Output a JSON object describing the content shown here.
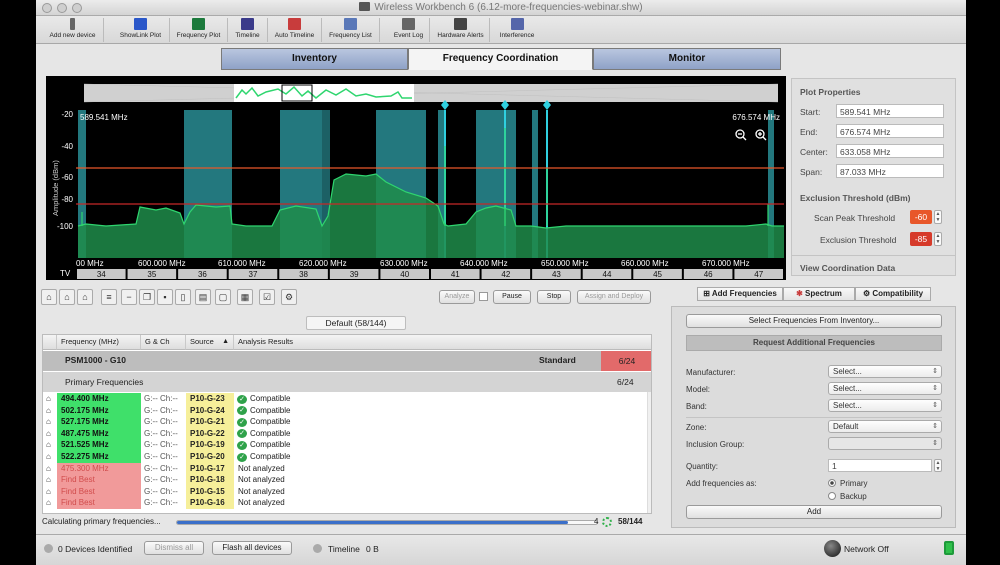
{
  "window": {
    "title": "Wireless Workbench 6 (6.12-more-frequencies-webinar.shw)"
  },
  "toolbar": [
    {
      "label": "Add new device",
      "icon": "add-device-icon",
      "color": "#666666"
    },
    {
      "label": "ShowLink Plot",
      "icon": "showlink-plot-icon",
      "color": "#2a57c9"
    },
    {
      "label": "Frequency Plot",
      "icon": "frequency-plot-icon",
      "color": "#1c7a3c"
    },
    {
      "label": "Timeline",
      "icon": "timeline-icon",
      "color": "#3a3a8a"
    },
    {
      "label": "Auto Timeline",
      "icon": "auto-timeline-icon",
      "color": "#c83c3c"
    },
    {
      "label": "Frequency List",
      "icon": "frequency-list-icon",
      "color": "#5a78b8"
    },
    {
      "label": "Event Log",
      "icon": "event-log-icon",
      "color": "#666666"
    },
    {
      "label": "Hardware Alerts",
      "icon": "hardware-alerts-icon",
      "color": "#444444"
    },
    {
      "label": "Interference",
      "icon": "interference-icon",
      "color": "#5566aa"
    }
  ],
  "tabs": [
    {
      "label": "Inventory",
      "active": false
    },
    {
      "label": "Frequency Coordination",
      "active": true
    },
    {
      "label": "Monitor",
      "active": false
    }
  ],
  "plot": {
    "start_label": "589.541 MHz",
    "end_label": "676.574 MHz",
    "ylabel": "Amplitude (dBm)",
    "y_ticks": [
      "-20",
      "-40",
      "-60",
      "-80",
      "-100"
    ],
    "x_ticks": [
      "00 MHz",
      "600.000 MHz",
      "610.000 MHz",
      "620.000 MHz",
      "630.000 MHz",
      "640.000 MHz",
      "650.000 MHz",
      "660.000 MHz",
      "670.000 MHz"
    ],
    "tv_label": "TV",
    "tv_channels": [
      "34",
      "35",
      "36",
      "37",
      "38",
      "39",
      "40",
      "41",
      "42",
      "43",
      "44",
      "45",
      "46",
      "47"
    ]
  },
  "plot_properties": {
    "title": "Plot Properties",
    "start_label": "Start:",
    "start": "589.541 MHz",
    "end_label": "End:",
    "end": "676.574 MHz",
    "center_label": "Center:",
    "center": "633.058 MHz",
    "span_label": "Span:",
    "span": "87.033 MHz",
    "exclusion_title": "Exclusion Threshold (dBm)",
    "scan_peak_label": "Scan Peak Threshold",
    "scan_peak": "-60",
    "exclusion_label": "Exclusion Threshold",
    "exclusion": "-85",
    "view_coord": "View Coordination Data"
  },
  "controls": {
    "analyze": "Analyze",
    "pause": "Pause",
    "stop": "Stop",
    "assign": "Assign and Deploy"
  },
  "group_selector": "Default (58/144)",
  "table": {
    "headers": [
      "Frequency (MHz)",
      "G & Ch",
      "Source",
      "Analysis Results"
    ],
    "sort_indicator": "▲",
    "group_name": "PSM1000 - G10",
    "group_type": "Standard",
    "group_count": "6/24",
    "subgroup": "Primary Frequencies",
    "subgroup_count": "6/24",
    "rows": [
      {
        "freq": "494.400 MHz",
        "gch": "G:-- Ch:--",
        "source": "P10-G-23",
        "result": "Compatible",
        "state": "ok"
      },
      {
        "freq": "502.175 MHz",
        "gch": "G:-- Ch:--",
        "source": "P10-G-24",
        "result": "Compatible",
        "state": "ok"
      },
      {
        "freq": "527.175 MHz",
        "gch": "G:-- Ch:--",
        "source": "P10-G-21",
        "result": "Compatible",
        "state": "ok"
      },
      {
        "freq": "487.475 MHz",
        "gch": "G:-- Ch:--",
        "source": "P10-G-22",
        "result": "Compatible",
        "state": "ok"
      },
      {
        "freq": "521.525 MHz",
        "gch": "G:-- Ch:--",
        "source": "P10-G-19",
        "result": "Compatible",
        "state": "ok"
      },
      {
        "freq": "522.275 MHz",
        "gch": "G:-- Ch:--",
        "source": "P10-G-20",
        "result": "Compatible",
        "state": "ok"
      },
      {
        "freq": "475.300 MHz",
        "gch": "G:-- Ch:--",
        "source": "P10-G-17",
        "result": "Not analyzed",
        "state": "na"
      },
      {
        "freq": "Find Best",
        "gch": "G:-- Ch:--",
        "source": "P10-G-18",
        "result": "Not analyzed",
        "state": "na"
      },
      {
        "freq": "Find Best",
        "gch": "G:-- Ch:--",
        "source": "P10-G-15",
        "result": "Not analyzed",
        "state": "na"
      },
      {
        "freq": "Find Best",
        "gch": "G:-- Ch:--",
        "source": "P10-G-16",
        "result": "Not analyzed",
        "state": "na"
      }
    ]
  },
  "status": {
    "message": "Calculating primary frequencies...",
    "progress": 0.93,
    "spinner_num": "4",
    "count": "58/144"
  },
  "right_panel": {
    "tabs": [
      "Add Frequencies",
      "Spectrum",
      "Compatibility"
    ],
    "select_inventory": "Select Frequencies From Inventory...",
    "request_title": "Request Additional Frequencies",
    "manufacturer_label": "Manufacturer:",
    "manufacturer": "Select...",
    "model_label": "Model:",
    "model": "Select...",
    "band_label": "Band:",
    "band": "Select...",
    "zone_label": "Zone:",
    "zone": "Default",
    "inclusion_label": "Inclusion Group:",
    "inclusion": "",
    "quantity_label": "Quantity:",
    "quantity": "1",
    "add_as_label": "Add frequencies as:",
    "primary": "Primary",
    "backup": "Backup",
    "add_button": "Add"
  },
  "bottom": {
    "devices": "0 Devices Identified",
    "dismiss": "Dismiss all",
    "flash": "Flash all devices",
    "timeline_label": "Timeline",
    "timeline_value": "0 B",
    "network": "Network Off"
  },
  "colors": {
    "compatible_green": "#3fe06a",
    "not_analyzed_red": "#f19a9a",
    "source_yellow": "#f6ef9a",
    "spectrum_green": "#2fd66f",
    "band_teal": "#2fa0a8",
    "threshold_orange": "#e8572a"
  }
}
